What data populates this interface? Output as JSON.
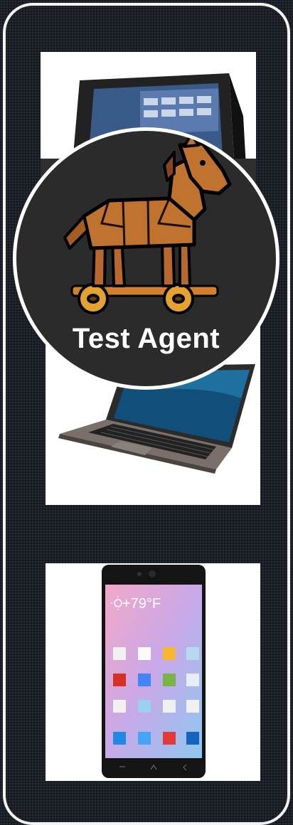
{
  "badge": {
    "label": "Test Agent",
    "icon": "trojan-horse-icon"
  },
  "devices": [
    {
      "name": "pos-terminal",
      "icon": "pos-terminal-image"
    },
    {
      "name": "laptop",
      "icon": "laptop-image"
    },
    {
      "name": "smartphone",
      "icon": "smartphone-image"
    }
  ],
  "phone_screen": {
    "temperature": "+79°F",
    "weather_icon": "sun-icon"
  },
  "colors": {
    "background": "#1c2028",
    "frame": "#f2f2f2",
    "horse_wood": "#b8682f",
    "wheel": "#e0a030"
  }
}
